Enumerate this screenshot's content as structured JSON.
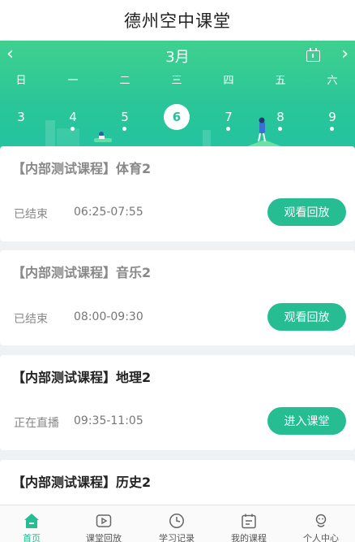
{
  "app": {
    "title": "德州空中课堂"
  },
  "calendar": {
    "month": "3月",
    "weekdays": [
      "日",
      "一",
      "二",
      "三",
      "四",
      "五",
      "六"
    ],
    "dates": [
      {
        "num": "3",
        "dot": false,
        "selected": false
      },
      {
        "num": "4",
        "dot": true,
        "selected": false
      },
      {
        "num": "5",
        "dot": true,
        "selected": false
      },
      {
        "num": "6",
        "dot": false,
        "selected": true
      },
      {
        "num": "7",
        "dot": true,
        "selected": false
      },
      {
        "num": "8",
        "dot": true,
        "selected": false
      },
      {
        "num": "9",
        "dot": true,
        "selected": false
      }
    ]
  },
  "courses": [
    {
      "title": "【内部测试课程】体育2",
      "status": "已结束",
      "time": "06:25-07:55",
      "button": "观看回放",
      "dim": true
    },
    {
      "title": "【内部测试课程】音乐2",
      "status": "已结束",
      "time": "08:00-09:30",
      "button": "观看回放",
      "dim": true
    },
    {
      "title": "【内部测试课程】地理2",
      "status": "正在直播",
      "time": "09:35-11:05",
      "button": "进入课堂",
      "dim": false
    },
    {
      "title": "【内部测试课程】历史2",
      "status": "",
      "time": "",
      "button": "",
      "dim": false
    }
  ],
  "tabs": [
    {
      "label": "首页",
      "icon": "home-icon"
    },
    {
      "label": "课堂回放",
      "icon": "play-icon"
    },
    {
      "label": "学习记录",
      "icon": "clock-icon"
    },
    {
      "label": "我的课程",
      "icon": "calendar-icon"
    },
    {
      "label": "个人中心",
      "icon": "user-icon"
    }
  ],
  "colors": {
    "accent": "#27bd92",
    "header_start": "#3fd08e",
    "header_end": "#23c3a0"
  }
}
